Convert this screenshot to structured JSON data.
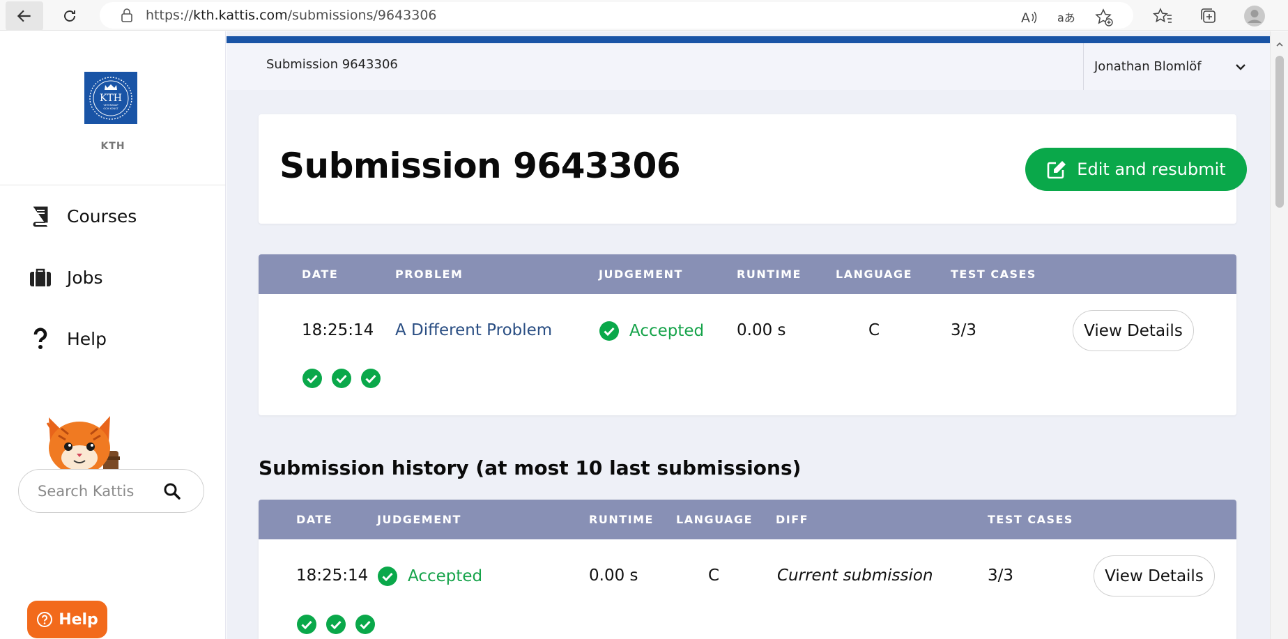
{
  "browser": {
    "url_prefix": "https://",
    "url_host": "kth.kattis.com",
    "url_path": "/submissions/9643306"
  },
  "sidebar": {
    "logo_text": "KTH",
    "logo_subtext": "VETENSKAP OCH KONST",
    "org_label": "KTH",
    "items": [
      {
        "label": "Courses",
        "icon": "book-icon"
      },
      {
        "label": "Jobs",
        "icon": "briefcase-icon"
      },
      {
        "label": "Help",
        "icon": "question-icon"
      }
    ],
    "search_placeholder": "Search Kattis",
    "help_button": "Help"
  },
  "topbar": {
    "breadcrumb": "Submission 9643306",
    "user_name": "Jonathan Blomlöf"
  },
  "header": {
    "title": "Submission 9643306",
    "edit_button": "Edit and resubmit"
  },
  "submission_table": {
    "headers": [
      "DATE",
      "PROBLEM",
      "JUDGEMENT",
      "RUNTIME",
      "LANGUAGE",
      "TEST CASES"
    ],
    "row": {
      "date": "18:25:14",
      "problem": "A Different Problem",
      "judgement": "Accepted",
      "runtime": "0.00 s",
      "language": "C",
      "test_cases": "3/3",
      "details_button": "View Details",
      "test_results": [
        "passed",
        "passed",
        "passed"
      ]
    }
  },
  "history": {
    "title": "Submission history (at most 10 last submissions)",
    "headers": [
      "DATE",
      "JUDGEMENT",
      "RUNTIME",
      "LANGUAGE",
      "DIFF",
      "TEST CASES"
    ],
    "rows": [
      {
        "date": "18:25:14",
        "judgement": "Accepted",
        "runtime": "0.00 s",
        "language": "C",
        "diff": "Current submission",
        "test_cases": "3/3",
        "details_button": "View Details",
        "test_results": [
          "passed",
          "passed",
          "passed"
        ]
      }
    ]
  },
  "colors": {
    "accent_blue": "#1954a6",
    "success_green": "#0aa84a",
    "table_header": "#8890b5",
    "help_orange": "#f26a1b"
  }
}
